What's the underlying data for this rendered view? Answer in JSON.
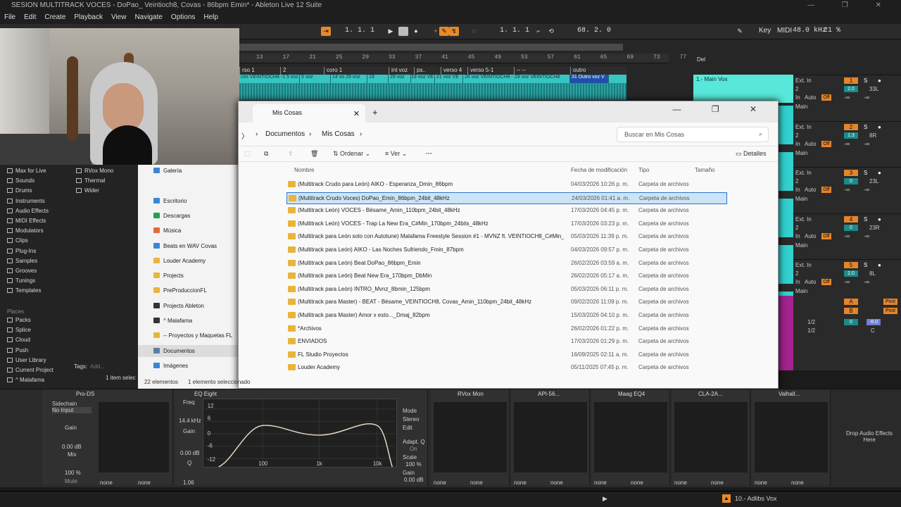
{
  "window": {
    "title": "SESION MULTITRACK VOCES - DoPao_ Veintioch8,  Covas - 86bpm Emin* - Ableton Live 12 Suite"
  },
  "menu": [
    "File",
    "Edit",
    "Create",
    "Playback",
    "View",
    "Navigate",
    "Options",
    "Help"
  ],
  "transport": {
    "position": "1. 1. 1",
    "end": "1. 1. 1",
    "loop_len": "68. 2. 0",
    "key": "Key",
    "midi": "MIDI",
    "sample_rate": "48.0 kHz",
    "cpu": "21 %"
  },
  "ruler": [
    "13",
    "17",
    "21",
    "25",
    "29",
    "33",
    "37",
    "41",
    "45",
    "49",
    "53",
    "57",
    "61",
    "65",
    "69",
    "73",
    "77"
  ],
  "locators": [
    "rso 1",
    "2",
    "coro 1",
    "int voz",
    "ps..",
    "verso 4",
    "verso 5-1",
    "-- --",
    "outro"
  ],
  "clips": [
    "ces VEINTIOCH8 -1 5 voz",
    "5 voz",
    "14 vo 29 voz",
    "19",
    "29 voz",
    "19 voz VE",
    "21 voz VE",
    "26 voz VEINTIOCH8 - 29 voz VEINTIOCH8",
    "31 Outro voz V"
  ],
  "arrange": {
    "del": "Del",
    "main_vox": "1.- Main Vox"
  },
  "mixer": {
    "tracks": [
      {
        "in": "Ext. In",
        "ch": "2",
        "num": "1",
        "vol": "2.0",
        "pan": "33L",
        "monitor": "Main"
      },
      {
        "in": "Ext. In",
        "ch": "2",
        "num": "2",
        "vol": "1.3",
        "pan": "8R",
        "monitor": "Main"
      },
      {
        "in": "Ext. In",
        "ch": "2",
        "num": "3",
        "vol": "0",
        "pan": "23L",
        "monitor": "Main"
      },
      {
        "in": "Ext. In",
        "ch": "2",
        "num": "4",
        "vol": "0",
        "pan": "23R",
        "monitor": "Main"
      },
      {
        "in": "Ext. In",
        "ch": "2",
        "num": "5",
        "vol": "2.0",
        "pan": "8L",
        "monitor": "Main"
      }
    ],
    "returns": [
      {
        "name": "A",
        "label": "Post"
      },
      {
        "name": "B",
        "label": "Post"
      }
    ],
    "master": {
      "ch": "1/2",
      "vol": "0",
      "db": "-6.0",
      "ch2": "1/2",
      "c": "C"
    },
    "auto": "Auto",
    "off": "Off",
    "in": "In",
    "inf": "-∞"
  },
  "browser": {
    "collections": [
      "RVox Mono",
      "Thermal",
      "Wider"
    ],
    "categories": [
      "Max for Live",
      "Sounds",
      "Drums",
      "Instruments",
      "Audio Effects",
      "MIDI Effects",
      "Modulators",
      "Clips",
      "Plug-Ins",
      "Samples",
      "Grooves",
      "Tunings",
      "Templates"
    ],
    "places_header": "Places",
    "places": [
      "Packs",
      "Splice",
      "Cloud",
      "Push",
      "User Library",
      "Current Project",
      "^ Malafama"
    ],
    "tags": "Tags:",
    "add": "Add...",
    "selection": "1 item selec"
  },
  "explorer": {
    "tab": "Mis Cosas",
    "breadcrumb": [
      "Documentos",
      "Mis Cosas"
    ],
    "search_placeholder": "Buscar en Mis Cosas",
    "toolbar": {
      "sort": "Ordenar",
      "view": "Ver",
      "more": "···",
      "details": "Detalles"
    },
    "columns": {
      "name": "Nombre",
      "date": "Fecha de modificación",
      "type": "Tipo",
      "size": "Tamaño"
    },
    "nav": [
      {
        "label": "Galería",
        "color": "#3a86d6"
      },
      {
        "label": "Escritorio",
        "color": "#3a86d6"
      },
      {
        "label": "Descargas",
        "color": "#2a9d4f"
      },
      {
        "label": "Música",
        "color": "#e06b3a"
      },
      {
        "label": "Beats en WAV Covas",
        "color": "#3a86d6"
      },
      {
        "label": "Louder Academy",
        "color": "#e8b43a"
      },
      {
        "label": "Projects",
        "color": "#e8b43a"
      },
      {
        "label": "PreProduccionFL",
        "color": "#e8b43a"
      },
      {
        "label": "Projects Ableton",
        "color": "#333333"
      },
      {
        "label": "^ Malafama",
        "color": "#333333"
      },
      {
        "label": "-- Proyectos y Maquetas FL",
        "color": "#e8b43a"
      },
      {
        "label": "Documentos",
        "color": "#5a7ea8"
      },
      {
        "label": "Imágenes",
        "color": "#3a86d6"
      }
    ],
    "files": [
      {
        "name": "(Multitrack Crudo para León) AIKO - Esperanza_Dmin_86bpm",
        "date": "04/03/2026 10:26 p. m.",
        "type": "Carpeta de archivos"
      },
      {
        "name": "(Multitrack Crudo Voces) DoPao_Emin_86bpm_24bit_48kHz",
        "date": "24/03/2026 01:41 a. m.",
        "type": "Carpeta de archivos"
      },
      {
        "name": "(Multitrack León) VOCES - Bésame_Amin_110bpm_24bit_48kHz",
        "date": "17/03/2026 04:45 p. m.",
        "type": "Carpeta de archivos"
      },
      {
        "name": "(Multitrack León) VOCES - Trap La New Era_C#Min_170bpm_24bits_48kHz",
        "date": "17/03/2026 03:23 p. m.",
        "type": "Carpeta de archivos"
      },
      {
        "name": "(Multitrack para León solo con Autotune) Malafama Freestyle Session #1 - MVNZ ft. VEINTIOCH8_C#Min_...",
        "date": "05/03/2026 11:39 p. m.",
        "type": "Carpeta de archivos"
      },
      {
        "name": "(Multitrack para León) AIKO - Las Noches Sufriendo_Fmin_87bpm",
        "date": "04/03/2026 09:57 p. m.",
        "type": "Carpeta de archivos"
      },
      {
        "name": "(Multitrack para León) Beat DoPao_86bpm_Emin",
        "date": "26/02/2026 03:59 a. m.",
        "type": "Carpeta de archivos"
      },
      {
        "name": "(Multitrack para León) Beat New Era_170bpm_DbMin",
        "date": "26/02/2026 05:17 a. m.",
        "type": "Carpeta de archivos"
      },
      {
        "name": "(Multitrack para León) INTRO_Mvnz_8bmin_125bpm",
        "date": "05/03/2026 06:11 p. m.",
        "type": "Carpeta de archivos"
      },
      {
        "name": "(Multitrack para Master) - BEAT - Bésame_VEINTIOCH8, Covas_Amin_110bpm_24bit_48kHz",
        "date": "09/02/2026 11:09 p. m.",
        "type": "Carpeta de archivos"
      },
      {
        "name": "(Multitrack para Master) Amor x esto..._Dmaj_82bpm",
        "date": "15/03/2026 04:10 p. m.",
        "type": "Carpeta de archivos"
      },
      {
        "name": "*Archivos",
        "date": "26/02/2026 01:22 p. m.",
        "type": "Carpeta de archivos"
      },
      {
        "name": "ENVIADOS",
        "date": "17/03/2026 01:29 p. m.",
        "type": "Carpeta de archivos"
      },
      {
        "name": "FL Studio Proyectos",
        "date": "16/09/2025 02:11 a. m.",
        "type": "Carpeta de archivos"
      },
      {
        "name": "Louder Academy",
        "date": "05/11/2025 07:45 p. m.",
        "type": "Carpeta de archivos"
      }
    ],
    "status": {
      "count": "22 elementos",
      "selected": "1 elemento seleccionado"
    }
  },
  "devices": {
    "prods": "Pro-DS",
    "sidechain": "Sidechain",
    "no_input": "No Input",
    "gain": "Gain",
    "gain_val": "0.00 dB",
    "mix": "Mix",
    "mix_val": "100 %",
    "mute": "Mute",
    "eq": "EQ Eight",
    "freq": "Freq",
    "freq_val": "14.4 kHz",
    "eq_gain": "Gain",
    "eq_gain_val": "0.00 dB",
    "q": "Q",
    "q_val": "1.06",
    "eq_scale": [
      "12",
      "6",
      "0",
      "-6",
      "-12"
    ],
    "eq_freqs": [
      "100",
      "1k",
      "10k"
    ],
    "mode": "Mode",
    "stereo": "Stereo",
    "edit": "Edit",
    "adapt": "Adapt. Q",
    "on": "On",
    "scale": "Scale",
    "scale_val": "100 %",
    "gain2": "Gain",
    "gain2_val": "0.00 dB",
    "plugins": [
      "RVox Mon",
      "API-56...",
      "Maag EQ4",
      "CLA-2A...",
      "Valhall..."
    ],
    "none": "none",
    "drop": "Drop Audio Effects Here"
  },
  "bottom": {
    "track": "10.- Adlibs Vox"
  }
}
